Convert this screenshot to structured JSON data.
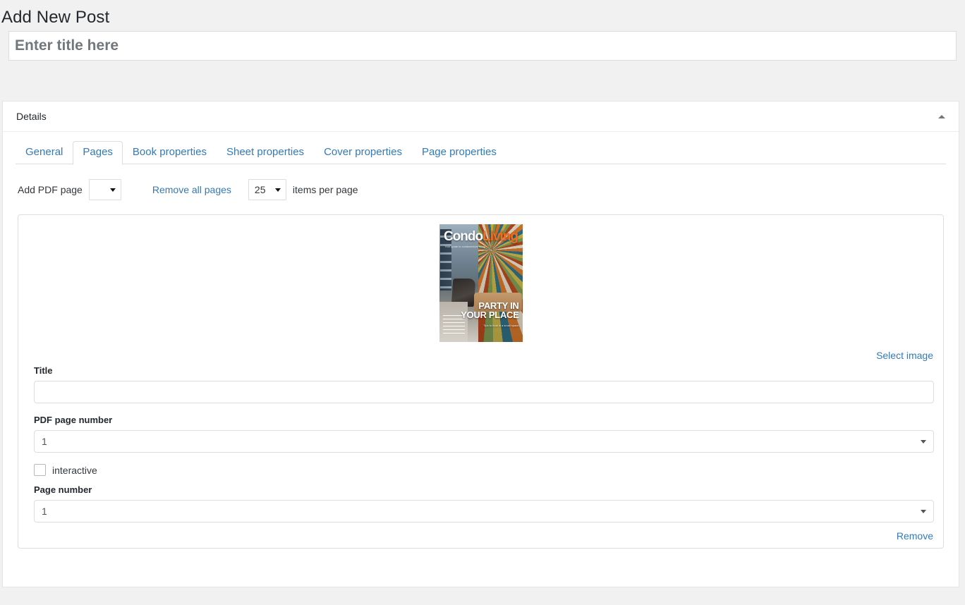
{
  "header": {
    "page_title": "Add New Post"
  },
  "title_field": {
    "name": "post-title",
    "value": "",
    "placeholder": "Enter title here"
  },
  "metabox": {
    "title": "Details",
    "toggle_icon": "triangle-up-icon"
  },
  "tabs": [
    {
      "label": "General",
      "active": false
    },
    {
      "label": "Pages",
      "active": true
    },
    {
      "label": "Book properties",
      "active": false
    },
    {
      "label": "Sheet properties",
      "active": false
    },
    {
      "label": "Cover properties",
      "active": false
    },
    {
      "label": "Page properties",
      "active": false
    }
  ],
  "toolbar": {
    "add_pdf_page_label": "Add PDF page",
    "add_pdf_page_value": "",
    "remove_all_pages_label": "Remove all pages",
    "items_per_page_value": "25",
    "items_per_page_label": "items per page"
  },
  "page_item": {
    "thumbnail": {
      "alt": "CondoLiving magazine cover",
      "masthead_part1": "Condo",
      "masthead_part2": "Living",
      "masthead_tagline": "Your guide to condominium living",
      "headline_line1": "PARTY IN",
      "headline_line2": "YOUR PLACE",
      "headline_sub": "Tips to host in a small space",
      "masthead_color_1": "#ffffff",
      "masthead_color_2": "#f26c21"
    },
    "select_image_label": "Select image",
    "title_label": "Title",
    "title_value": "",
    "pdf_page_number_label": "PDF page number",
    "pdf_page_number_value": "1",
    "interactive_label": "interactive",
    "interactive_checked": false,
    "page_number_label": "Page number",
    "page_number_value": "1",
    "remove_label": "Remove"
  },
  "colors": {
    "accent_link": "#337ab7",
    "page_background": "#f1f1f1",
    "panel_background": "#ffffff",
    "border": "#dddddd",
    "text": "#23282d"
  }
}
